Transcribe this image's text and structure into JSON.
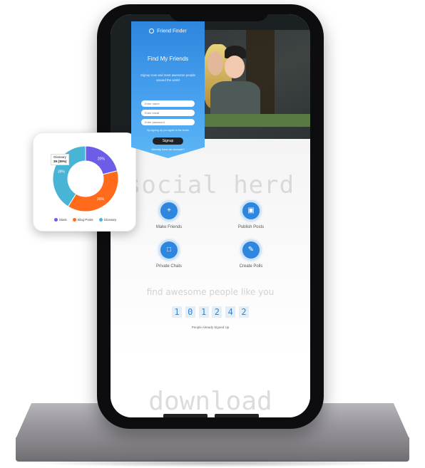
{
  "colors": {
    "brand_blue": "#2e86de",
    "panel_gradient_end": "#5cb6f5",
    "series_static": "#6c5ce7",
    "series_blog_posts": "#ff6b1a",
    "series_glossary": "#48b4d6"
  },
  "form_panel": {
    "brand_name": "Friend Finder",
    "brand_icon": "circle-logo-icon",
    "heading": "Find My Friends",
    "subheading": "Signup now and meet awesome people around the world",
    "name_placeholder": "Enter name",
    "email_placeholder": "Enter email",
    "password_placeholder": "Enter password",
    "terms": "By signing up you agree to the terms",
    "signup_label": "Signup",
    "login_link": "Already have an account?"
  },
  "main": {
    "title": "social herd",
    "features": [
      {
        "label": "Make Friends",
        "icon": "add-user-icon"
      },
      {
        "label": "Publish Posts",
        "icon": "image-icon"
      },
      {
        "label": "Private Chats",
        "icon": "chat-icon"
      },
      {
        "label": "Create Polls",
        "icon": "edit-icon"
      }
    ],
    "find_title": "find awesome people like you",
    "counter_digits": [
      "1",
      "0",
      "1",
      "2",
      "4",
      "2"
    ],
    "counter_note": "People Already Signed Up"
  },
  "footer": {
    "title": "download"
  },
  "chart_data": {
    "type": "pie",
    "donut": true,
    "categories": [
      "Static",
      "Blog Posts",
      "Glossary"
    ],
    "values": [
      20,
      36,
      39
    ],
    "slice_labels": [
      "20%",
      "36%",
      "39%"
    ],
    "tooltip": {
      "category": "Glossary",
      "value": "39 (39%)"
    },
    "legend_position": "bottom"
  }
}
